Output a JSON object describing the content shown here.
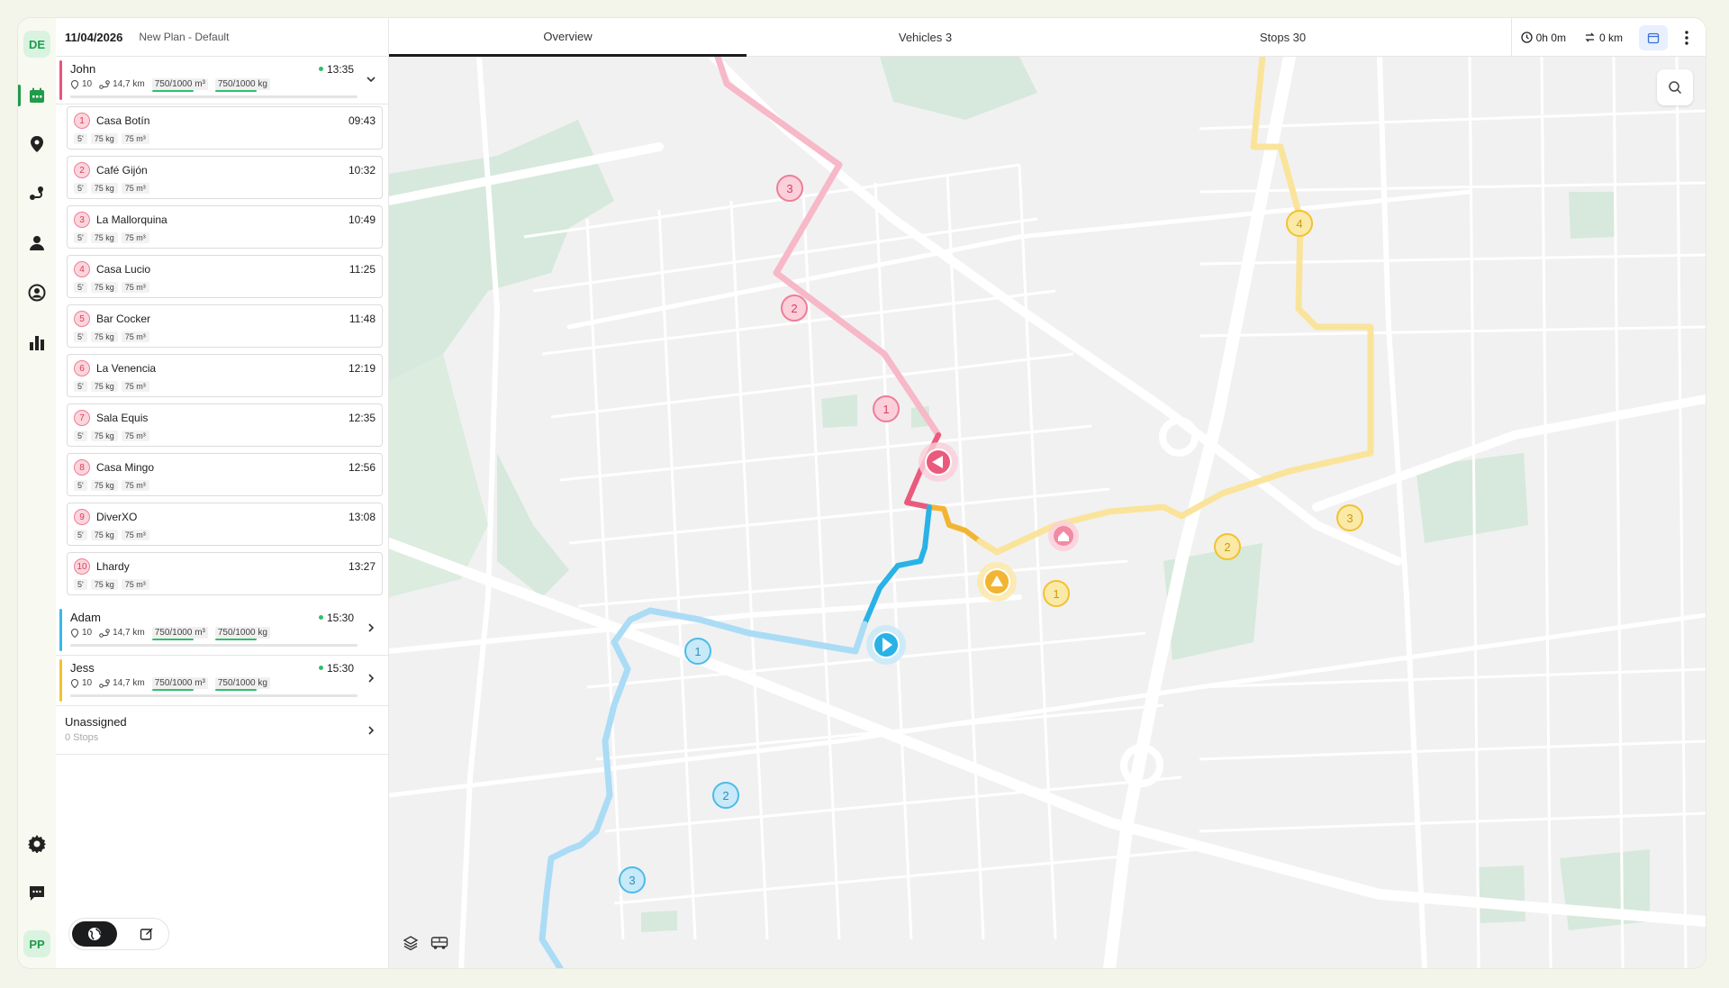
{
  "header": {
    "date": "11/04/2026",
    "plan": "New Plan - Default"
  },
  "tabs": [
    {
      "label": "Overview",
      "active": true
    },
    {
      "label": "Vehicles 3",
      "active": false
    },
    {
      "label": "Stops 30",
      "active": false
    }
  ],
  "summary": {
    "time": "0h 0m",
    "distance": "0 km"
  },
  "rail": {
    "top_badge": "DE",
    "bottom_badge": "PP"
  },
  "routes": [
    {
      "name": "John",
      "color": "#e8557a",
      "time": "13:35",
      "stops": "10",
      "distance": "14,7 km",
      "volume": "750/1000 m³",
      "weight": "750/1000 kg",
      "expanded": true
    },
    {
      "name": "Adam",
      "color": "#3ab6e8",
      "time": "15:30",
      "stops": "10",
      "distance": "14,7 km",
      "volume": "750/1000 m³",
      "weight": "750/1000 kg",
      "expanded": false
    },
    {
      "name": "Jess",
      "color": "#f2c230",
      "time": "15:30",
      "stops": "10",
      "distance": "14,7 km",
      "volume": "750/1000 m³",
      "weight": "750/1000 kg",
      "expanded": false
    }
  ],
  "stops": [
    {
      "num": "1",
      "name": "Casa Botín",
      "time": "09:43",
      "dur": "5'",
      "weight": "75 kg",
      "vol": "75 m³"
    },
    {
      "num": "2",
      "name": "Café Gijón",
      "time": "10:32",
      "dur": "5'",
      "weight": "75 kg",
      "vol": "75 m³"
    },
    {
      "num": "3",
      "name": "La Mallorquina",
      "time": "10:49",
      "dur": "5'",
      "weight": "75 kg",
      "vol": "75 m³"
    },
    {
      "num": "4",
      "name": "Casa Lucio",
      "time": "11:25",
      "dur": "5'",
      "weight": "75 kg",
      "vol": "75 m³"
    },
    {
      "num": "5",
      "name": "Bar Cocker",
      "time": "11:48",
      "dur": "5'",
      "weight": "75 kg",
      "vol": "75 m³"
    },
    {
      "num": "6",
      "name": "La Venencia",
      "time": "12:19",
      "dur": "5'",
      "weight": "75 kg",
      "vol": "75 m³"
    },
    {
      "num": "7",
      "name": "Sala Equis",
      "time": "12:35",
      "dur": "5'",
      "weight": "75 kg",
      "vol": "75 m³"
    },
    {
      "num": "8",
      "name": "Casa Mingo",
      "time": "12:56",
      "dur": "5'",
      "weight": "75 kg",
      "vol": "75 m³"
    },
    {
      "num": "9",
      "name": "DiverXO",
      "time": "13:08",
      "dur": "5'",
      "weight": "75 kg",
      "vol": "75 m³"
    },
    {
      "num": "10",
      "name": "Lhardy",
      "time": "13:27",
      "dur": "5'",
      "weight": "75 kg",
      "vol": "75 m³"
    }
  ],
  "unassigned": {
    "title": "Unassigned",
    "count": "0 Stops"
  },
  "map": {
    "markers": {
      "pink": [
        "3",
        "2",
        "1"
      ],
      "blue": [
        "1",
        "2",
        "3"
      ],
      "yellow": [
        "4",
        "3",
        "2",
        "1"
      ]
    }
  }
}
